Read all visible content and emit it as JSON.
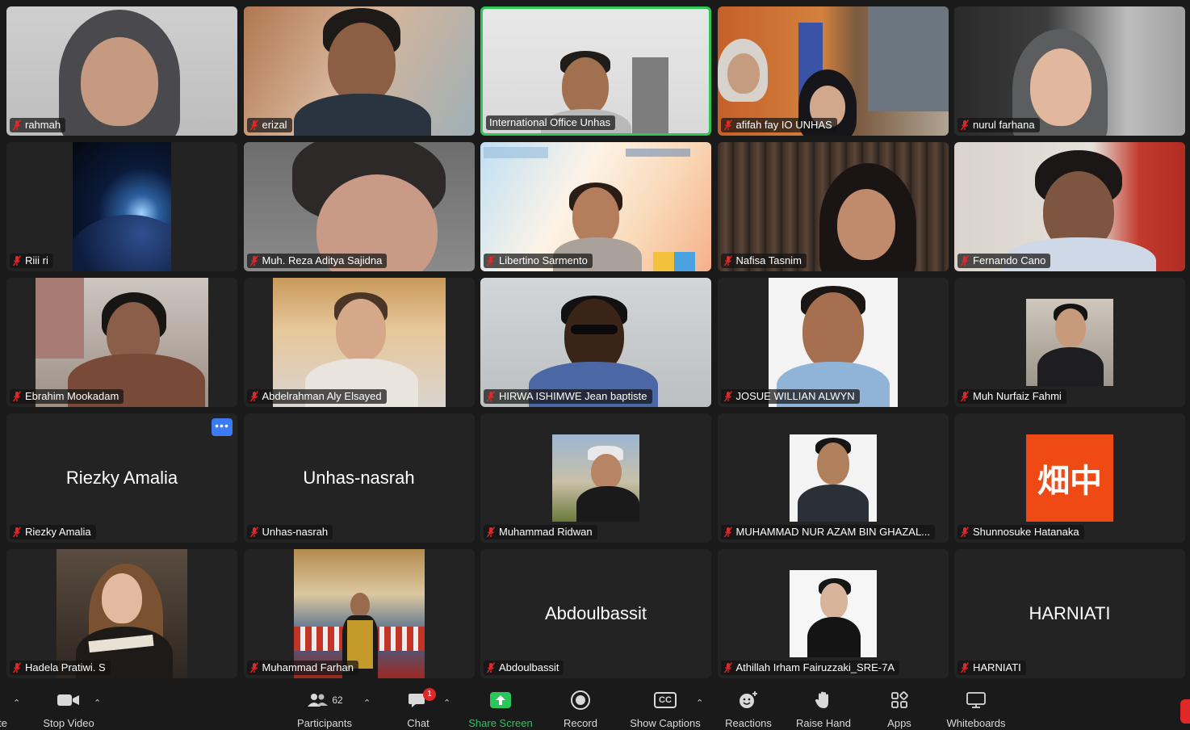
{
  "participants": [
    {
      "name": "rahmah",
      "display": "video"
    },
    {
      "name": "erizal",
      "display": "video"
    },
    {
      "name": "International Office Unhas",
      "display": "video",
      "active_speaker": true
    },
    {
      "name": "afifah fay IO UNHAS",
      "display": "video"
    },
    {
      "name": "nurul farhana",
      "display": "video"
    },
    {
      "name": "Riii ri",
      "display": "video"
    },
    {
      "name": "Muh. Reza Aditya Sajidna",
      "display": "video"
    },
    {
      "name": "Libertino Sarmento",
      "display": "video"
    },
    {
      "name": "Nafisa Tasnim",
      "display": "video"
    },
    {
      "name": "Fernando Cano",
      "display": "video"
    },
    {
      "name": "Ebrahim Mookadam",
      "display": "video"
    },
    {
      "name": "Abdelrahman Aly Elsayed",
      "display": "video"
    },
    {
      "name": "HIRWA ISHIMWE Jean baptiste",
      "display": "video"
    },
    {
      "name": "JOSUE WILLIAN ALWYN",
      "display": "video"
    },
    {
      "name": "Muh Nurfaiz Fahmi",
      "display": "video"
    },
    {
      "name": "Riezky Amalia",
      "display": "name",
      "center_text": "Riezky Amalia",
      "more_button": "•••"
    },
    {
      "name": "Unhas-nasrah",
      "display": "name",
      "center_text": "Unhas-nasrah"
    },
    {
      "name": "Muhammad Ridwan",
      "display": "picture"
    },
    {
      "name": "MUHAMMAD NUR AZAM BIN GHAZAL...",
      "display": "picture"
    },
    {
      "name": "Shunnosuke Hatanaka",
      "display": "picture",
      "avatar_text": "畑中"
    },
    {
      "name": "Hadela Pratiwi. S",
      "display": "video"
    },
    {
      "name": "Muhammad Farhan",
      "display": "video"
    },
    {
      "name": "Abdoulbassit",
      "display": "name",
      "center_text": "Abdoulbassit"
    },
    {
      "name": "Athillah Irham Fairuzzaki_SRE-7A",
      "display": "picture"
    },
    {
      "name": "HARNIATI",
      "display": "name",
      "center_text": "HARNIATI"
    }
  ],
  "toolbar": {
    "mute_label_fragment": "te",
    "stop_video_label": "Stop Video",
    "participants_label": "Participants",
    "participants_count": "62",
    "chat_label": "Chat",
    "chat_badge": "1",
    "share_screen_label": "Share Screen",
    "record_label": "Record",
    "show_captions_label": "Show Captions",
    "captions_icon_text": "CC",
    "reactions_label": "Reactions",
    "raise_hand_label": "Raise Hand",
    "apps_label": "Apps",
    "whiteboards_label": "Whiteboards"
  },
  "colors": {
    "active_speaker_border": "#2ec756",
    "share_screen": "#29c65a",
    "muted_mic": "#e02828",
    "badge": "#e02828",
    "more_button": "#3b7cf4",
    "avatar_orange": "#f04a14"
  }
}
